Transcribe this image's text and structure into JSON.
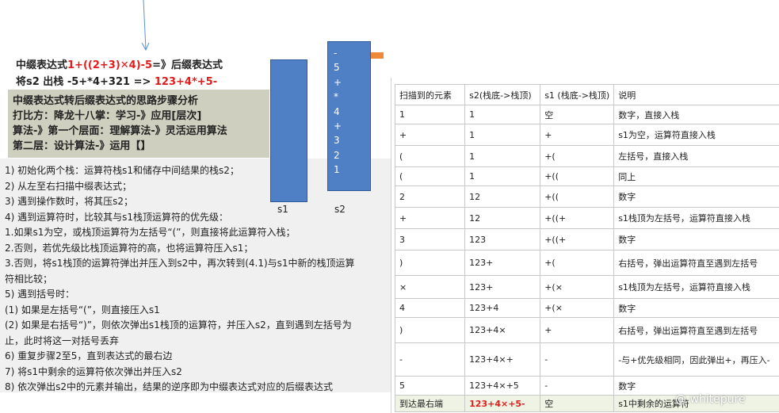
{
  "heading": {
    "line1_prefix": "中缀表达式",
    "line1_expr": "1+((2+3)✕4)-5",
    "line1_suffix": "=》后缀表达式",
    "line2_prefix": "将s2 出栈 -5+*4+321 =>",
    "line2_result": "123+4*+5-"
  },
  "summary": {
    "lines": [
      "中缀表达式转后缀表达式的思路步骤分析",
      "打比方：降龙十八掌：学习-》应用[层次]",
      "算法-》第一个层面：理解算法-》灵活运用算法",
      "第二层：设计算法-》运用【】"
    ]
  },
  "steps": {
    "lines": [
      "1) 初始化两个栈：运算符栈s1和储存中间结果的栈s2；",
      "2) 从左至右扫描中缀表达式；",
      "3) 遇到操作数时，将其压s2；",
      "4) 遇到运算符时，比较其与s1栈顶运算符的优先级：",
      "1.如果s1为空，或栈顶运算符为左括号“(”，则直接将此运算符入栈；",
      "2.否则，若优先级比栈顶运算符的高，也将运算符压入s1；",
      "3.否则，将s1栈顶的运算符弹出并压入到s2中，再次转到(4.1)与s1中新的栈顶运算",
      "符相比较；",
      "5) 遇到括号时：",
      "(1) 如果是左括号“(”，则直接压入s1",
      "(2) 如果是右括号“)”，则依次弹出s1栈顶的运算符，并压入s2，直到遇到左括号为",
      "止，此时将这一对括号丢弃",
      "6) 重复步骤2至5，直到表达式的最右边",
      "7) 将s1中剩余的运算符依次弹出并压入s2",
      "8) 依次弹出s2中的元素并输出，结果的逆序即为中缀表达式对应的后缀表达式"
    ]
  },
  "stacks": {
    "s1_label": "s1",
    "s2_label": "s2",
    "s2_items": [
      "-",
      "5",
      "+",
      "*",
      "4",
      "+",
      "3",
      "2",
      "1"
    ]
  },
  "table": {
    "headers": [
      "扫描到的元素",
      "s2(栈底->栈顶)",
      "s1 (栈底->栈顶)",
      "说明"
    ],
    "rows": [
      [
        "1",
        "1",
        "空",
        "数字，直接入栈"
      ],
      [
        "+",
        "1",
        "+",
        "s1为空，运算符直接入栈"
      ],
      [
        "(",
        "1",
        "+(",
        "左括号，直接入栈"
      ],
      [
        "(",
        "1",
        "+((",
        "同上"
      ],
      [
        "2",
        "12",
        "+((",
        "数字"
      ],
      [
        "+",
        "12",
        "+((+",
        "s1栈顶为左括号，运算符直接入栈"
      ],
      [
        "3",
        "123",
        "+((+",
        "数字"
      ],
      [
        ")",
        "123+",
        "+(",
        "右括号，弹出运算符直至遇到左括号"
      ],
      [
        "×",
        "123+",
        "+(×",
        "s1栈顶为左括号，运算符直接入栈"
      ],
      [
        "4",
        "123+4",
        "+(×",
        "数字"
      ],
      [
        ")",
        "123+4×",
        "+",
        "右括号，弹出运算符直至遇到左括号"
      ],
      [
        "-",
        "123+4×+",
        "-",
        "-与+优先级相同，因此弹出+，再压入-"
      ],
      [
        "5",
        "123+4×+5",
        "-",
        "数字"
      ],
      [
        "到达最右端",
        "123+4×+5-",
        "空",
        "s1中剩余的运算符"
      ]
    ]
  },
  "watermark": "@ whitepure",
  "colors": {
    "stack_blue": "#4f7fc5",
    "highlight_red": "#e21b1b",
    "summary_bg": "#cfcfc0",
    "orange_arrow": "#f0883a",
    "purple_arrow": "#8064a2"
  }
}
